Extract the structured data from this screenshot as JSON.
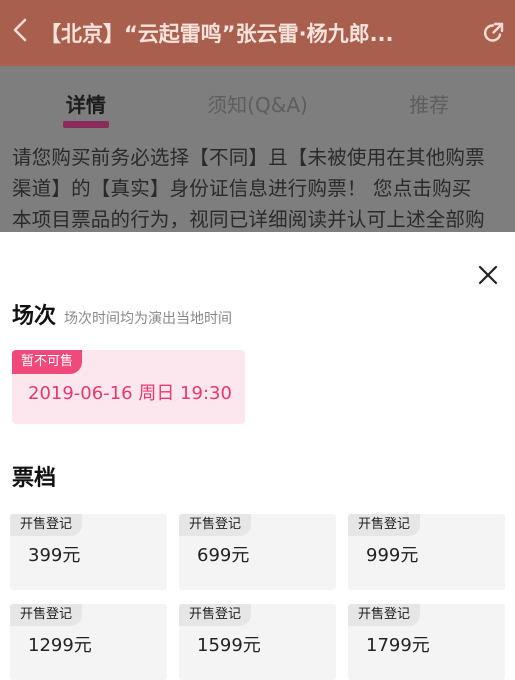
{
  "header": {
    "back_icon": "chevron-left-icon",
    "title": "【北京】“云起雷鸣”张云雷·杨九郎...",
    "share_icon": "share-icon"
  },
  "tabs": [
    {
      "label": "详情",
      "active": true
    },
    {
      "label": "须知(Q&A)",
      "active": false
    },
    {
      "label": "推荐",
      "active": false
    }
  ],
  "description": {
    "lines": [
      "请您购买前务必选择【不同】且【未被使用在其他购票",
      "渠道】的【真实】身份证信息进行购票！ 您点击购买",
      "本项目票品的行为，视同已详细阅读并认可上述全部购"
    ]
  },
  "sheet": {
    "close_icon": "close-icon",
    "session": {
      "heading": "场次",
      "note": "场次时间均为演出当地时间",
      "badge": "暂不可售",
      "date": "2019-06-16 周日 19:30"
    },
    "tiers_heading": "票档",
    "tiers": [
      {
        "badge": "开售登记",
        "price": "399元"
      },
      {
        "badge": "开售登记",
        "price": "699元"
      },
      {
        "badge": "开售登记",
        "price": "999元"
      },
      {
        "badge": "开售登记",
        "price": "1299元"
      },
      {
        "badge": "开售登记",
        "price": "1599元"
      },
      {
        "badge": "开售登记",
        "price": "1799元"
      }
    ]
  },
  "colors": {
    "header_bg": "#a85f4e",
    "accent_pink": "#ef4a7a",
    "session_card_bg": "#fde7ee",
    "tier_card_bg": "#f4f4f4"
  }
}
